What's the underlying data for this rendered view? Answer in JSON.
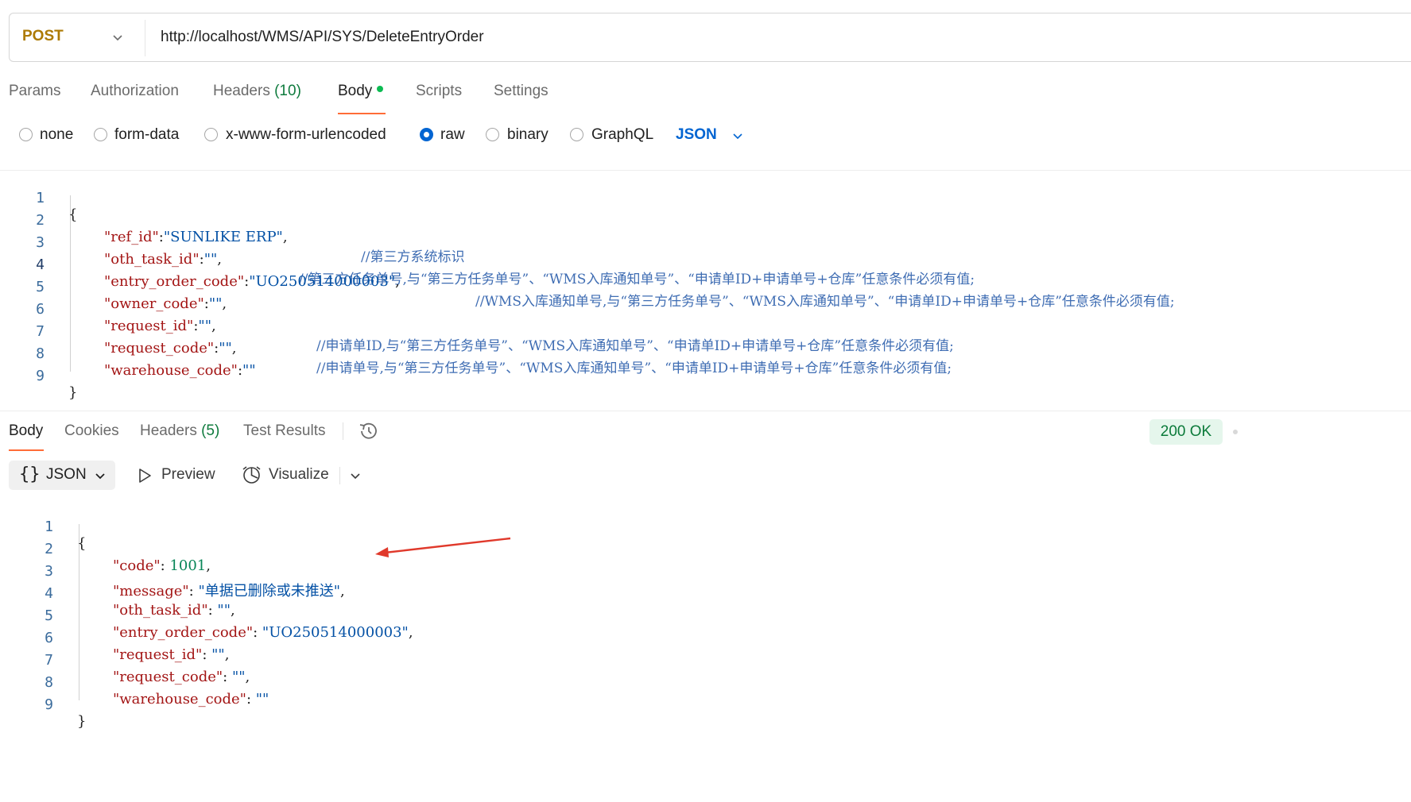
{
  "request": {
    "method": "POST",
    "url": "http://localhost/WMS/API/SYS/DeleteEntryOrder"
  },
  "request_tabs": [
    {
      "label": "Params"
    },
    {
      "label": "Authorization"
    },
    {
      "label": "Headers",
      "count": "(10)"
    },
    {
      "label": "Body"
    },
    {
      "label": "Scripts"
    },
    {
      "label": "Settings"
    }
  ],
  "body_types": [
    {
      "label": "none",
      "selected": false
    },
    {
      "label": "form-data",
      "selected": false
    },
    {
      "label": "x-www-form-urlencoded",
      "selected": false
    },
    {
      "label": "raw",
      "selected": true
    },
    {
      "label": "binary",
      "selected": false
    },
    {
      "label": "GraphQL",
      "selected": false
    }
  ],
  "body_format": "JSON",
  "request_body": [
    {
      "n": "1",
      "open": "{"
    },
    {
      "n": "2",
      "key": "\"ref_id\"",
      "sep": ":",
      "val": "\"SUNLIKE ERP\"",
      "tail": ",",
      "comment": "//第三方系统标识"
    },
    {
      "n": "3",
      "key": "\"oth_task_id\"",
      "sep": ":",
      "val": "\"\"",
      "tail": ",",
      "comment": "//第三方任务单号,与“第三方任务单号”、“WMS入库通知单号”、“申请单ID+申请单号+仓库”任意条件必须有值;"
    },
    {
      "n": "4",
      "key": "\"entry_order_code\"",
      "sep": ":",
      "val": "\"UO250514000003\"",
      "tail": ",",
      "comment": "//WMS入库通知单号,与“第三方任务单号”、“WMS入库通知单号”、“申请单ID+申请单号+仓库”任意条件必须有值;"
    },
    {
      "n": "5",
      "key": "\"owner_code\"",
      "sep": ":",
      "val": "\"\"",
      "tail": ",",
      "comment": ""
    },
    {
      "n": "6",
      "key": "\"request_id\"",
      "sep": ":",
      "val": "\"\"",
      "tail": ",",
      "comment": "//申请单ID,与“第三方任务单号”、“WMS入库通知单号”、“申请单ID+申请单号+仓库”任意条件必须有值;"
    },
    {
      "n": "7",
      "key": "\"request_code\"",
      "sep": ":",
      "val": "\"\"",
      "tail": ",",
      "comment": "//申请单号,与“第三方任务单号”、“WMS入库通知单号”、“申请单ID+申请单号+仓库”任意条件必须有值;"
    },
    {
      "n": "8",
      "key": "\"warehouse_code\"",
      "sep": ":",
      "val": "\"\"",
      "tail": "",
      "comment": ""
    },
    {
      "n": "9",
      "open": "}"
    }
  ],
  "response_tabs": [
    {
      "label": "Body"
    },
    {
      "label": "Cookies"
    },
    {
      "label": "Headers",
      "count": "(5)"
    },
    {
      "label": "Test Results"
    }
  ],
  "status": {
    "label": "200 OK",
    "color": "#0b7a3a"
  },
  "response_toolbar": {
    "format": "JSON",
    "preview": "Preview",
    "visualize": "Visualize"
  },
  "response_body": [
    {
      "n": "1",
      "open": "{"
    },
    {
      "n": "2",
      "key": "\"code\"",
      "sep": ": ",
      "num": "1001",
      "tail": ","
    },
    {
      "n": "3",
      "key": "\"message\"",
      "sep": ": ",
      "val": "\"单据已删除或未推送\"",
      "tail": ","
    },
    {
      "n": "4",
      "key": "\"oth_task_id\"",
      "sep": ": ",
      "val": "\"\"",
      "tail": ","
    },
    {
      "n": "5",
      "key": "\"entry_order_code\"",
      "sep": ": ",
      "val": "\"UO250514000003\"",
      "tail": ","
    },
    {
      "n": "6",
      "key": "\"request_id\"",
      "sep": ": ",
      "val": "\"\"",
      "tail": ","
    },
    {
      "n": "7",
      "key": "\"request_code\"",
      "sep": ": ",
      "val": "\"\"",
      "tail": ","
    },
    {
      "n": "8",
      "key": "\"warehouse_code\"",
      "sep": ": ",
      "val": "\"\"",
      "tail": ""
    },
    {
      "n": "9",
      "open": "}"
    }
  ],
  "colors": {
    "accent_tab": "#ff6c37",
    "method": "#ad7a03",
    "link_blue": "#0265d2",
    "annotation_arrow": "#e0392b"
  },
  "icons": [
    "chevron-down-icon",
    "history-icon",
    "play-icon",
    "visualize-icon",
    "braces-icon"
  ]
}
